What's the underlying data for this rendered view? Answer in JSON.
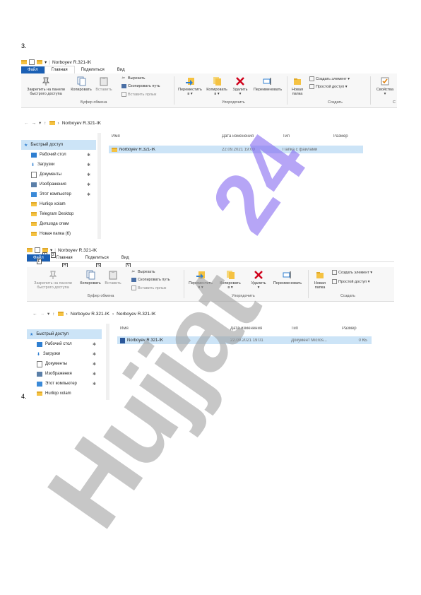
{
  "labels": {
    "step3": "3.",
    "step4": "4."
  },
  "shot1": {
    "title": "Norboyev R.321-IK",
    "tabs": [
      "Файл",
      "Главная",
      "Поделиться",
      "Вид"
    ],
    "ribbon": {
      "pin": [
        "Закрепить на панели",
        "быстрого доступа"
      ],
      "copy": "Копировать",
      "paste": "Вставить",
      "cut": "Вырезать",
      "copy_path": "Скопировать путь",
      "paste_shortcut": "Вставить ярлык",
      "clipboard_group": "Буфер обмена",
      "move": [
        "Переместить",
        "в ▾"
      ],
      "copy_to": [
        "Копировать",
        "в ▾"
      ],
      "delete": [
        "Удалить",
        "▾"
      ],
      "rename": "Переименовать",
      "organize_group": "Упорядочить",
      "new_folder": [
        "Новая",
        "папка"
      ],
      "new_item": "Создать элемент ▾",
      "easy_access": "Простой доступ ▾",
      "create_group": "Создать",
      "properties": [
        "Свойства",
        "▾"
      ],
      "open_group": "С"
    },
    "address": [
      "Norboyev R.321-IK"
    ],
    "nav": [
      {
        "label": "Быстрый доступ",
        "head": true,
        "pin": false,
        "icon": "star-icon"
      },
      {
        "label": "Рабочий стол",
        "pin": true,
        "icon": "desktop-icon"
      },
      {
        "label": "Загрузки",
        "pin": true,
        "icon": "download-icon"
      },
      {
        "label": "Документы",
        "pin": true,
        "icon": "documents-icon"
      },
      {
        "label": "Изображения",
        "pin": true,
        "icon": "pictures-icon"
      },
      {
        "label": "Этот компьютер",
        "pin": true,
        "icon": "computer-icon"
      },
      {
        "label": "Hurliqo xolam",
        "pin": false,
        "icon": "folder-icon"
      },
      {
        "label": "Telegram Desktop",
        "pin": false,
        "icon": "folder-icon"
      },
      {
        "label": "Дилшода опам",
        "pin": false,
        "icon": "folder-icon"
      },
      {
        "label": "Новая папка (6)",
        "pin": false,
        "icon": "folder-icon"
      }
    ],
    "columns": [
      "Имя",
      "Дата изменения",
      "Тип",
      "Размер"
    ],
    "rows": [
      {
        "name": "Norboyev R.321-IK",
        "date": "22.09.2021 19:00",
        "type": "Папка с файлами",
        "size": ""
      }
    ]
  },
  "shot2": {
    "title": "Norboyev R.321-IK",
    "tabs": [
      "Файл",
      "Главная",
      "Поделиться",
      "Вид"
    ],
    "keytips": {
      "qa1": "1",
      "qa2": "2",
      "file": "F",
      "home": "H",
      "share": "S",
      "view": "V"
    },
    "ribbon": {
      "pin": [
        "Закрепить на панели",
        "быстрого доступа"
      ],
      "copy": "Копировать",
      "paste": "Вставить",
      "cut": "Вырезать",
      "copy_path": "Скопировать путь",
      "paste_shortcut": "Вставить ярлык",
      "clipboard_group": "Буфер обмена",
      "move": [
        "Переместить",
        "в ▾"
      ],
      "copy_to": [
        "Копировать",
        "в ▾"
      ],
      "delete": [
        "Удалить",
        "▾"
      ],
      "rename": "Переименовать",
      "organize_group": "Упорядочить",
      "new_folder": [
        "Новая",
        "папка"
      ],
      "new_item": "Создать элемент ▾",
      "easy_access": "Простой доступ ▾",
      "create_group": "Создать"
    },
    "address": [
      "Norboyev R.321-IK",
      "Norboyev R.321-IK"
    ],
    "nav": [
      {
        "label": "Быстрый доступ",
        "head": true,
        "pin": false,
        "icon": "star-icon"
      },
      {
        "label": "Рабочий стол",
        "pin": true,
        "icon": "desktop-icon"
      },
      {
        "label": "Загрузки",
        "pin": true,
        "icon": "download-icon"
      },
      {
        "label": "Документы",
        "pin": true,
        "icon": "documents-icon"
      },
      {
        "label": "Изображения",
        "pin": true,
        "icon": "pictures-icon"
      },
      {
        "label": "Этот компьютер",
        "pin": true,
        "icon": "computer-icon"
      },
      {
        "label": "Hurliqo xolam",
        "pin": false,
        "icon": "folder-icon"
      }
    ],
    "columns": [
      "Имя",
      "Дата изменения",
      "Тип",
      "Размер"
    ],
    "rows": [
      {
        "name": "Norboyev R.321-IK",
        "date": "22.09.2021 19:01",
        "type": "Документ Micros...",
        "size": "0 КБ"
      }
    ]
  },
  "watermark": {
    "text1": "24",
    "text2": "Hujjat",
    "color1": "#7b5cf0",
    "color2": "#9a9a9a"
  },
  "colors": {
    "accent": "#1a5fb4",
    "selection": "#cce4f7",
    "folder": "#f5c242"
  }
}
